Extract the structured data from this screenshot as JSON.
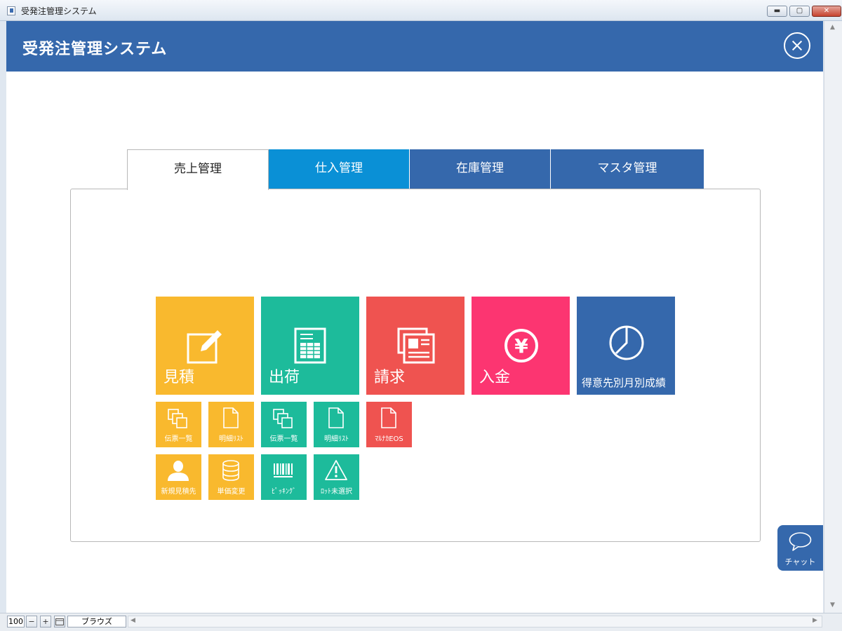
{
  "window": {
    "title": "受発注管理システム",
    "minimize": "▬",
    "maximize": "▢",
    "close": "✕"
  },
  "header": {
    "title": "受発注管理システム"
  },
  "tabs": [
    {
      "label": "売上管理",
      "active": true
    },
    {
      "label": "仕入管理"
    },
    {
      "label": "在庫管理"
    },
    {
      "label": "マスタ管理"
    }
  ],
  "tiles": {
    "big": [
      {
        "label": "見積",
        "icon": "edit-icon",
        "color": "#f9b92e"
      },
      {
        "label": "出荷",
        "icon": "spreadsheet-icon",
        "color": "#1dbb9b"
      },
      {
        "label": "請求",
        "icon": "newspaper-icon",
        "color": "#ef5350"
      },
      {
        "label": "入金",
        "icon": "yen-icon",
        "color": "#fc3571"
      },
      {
        "label": "得意先別月別成績",
        "icon": "pie-chart-icon",
        "color": "#3568ac"
      }
    ],
    "row1": [
      {
        "label": "伝票一覧",
        "icon": "copy-icon"
      },
      {
        "label": "明細ﾘｽﾄ",
        "icon": "document-icon"
      },
      {
        "label": "伝票一覧",
        "icon": "copy-icon"
      },
      {
        "label": "明細ﾘｽﾄ",
        "icon": "document-icon"
      },
      {
        "label": "ﾏﾙﾅｶEOS",
        "icon": "document-icon"
      }
    ],
    "row2": [
      {
        "label": "新規見積先",
        "icon": "user-icon"
      },
      {
        "label": "単価変更",
        "icon": "database-icon"
      },
      {
        "label": "ﾋﾟｯｷﾝｸﾞ",
        "icon": "barcode-icon"
      },
      {
        "label": "ﾛｯﾄ未選択",
        "icon": "warning-icon"
      }
    ]
  },
  "chat": {
    "label": "チャット"
  },
  "statusbar": {
    "zoom": "100",
    "zoom_out": "−",
    "zoom_in": "+",
    "mode": "ブラウズ"
  }
}
